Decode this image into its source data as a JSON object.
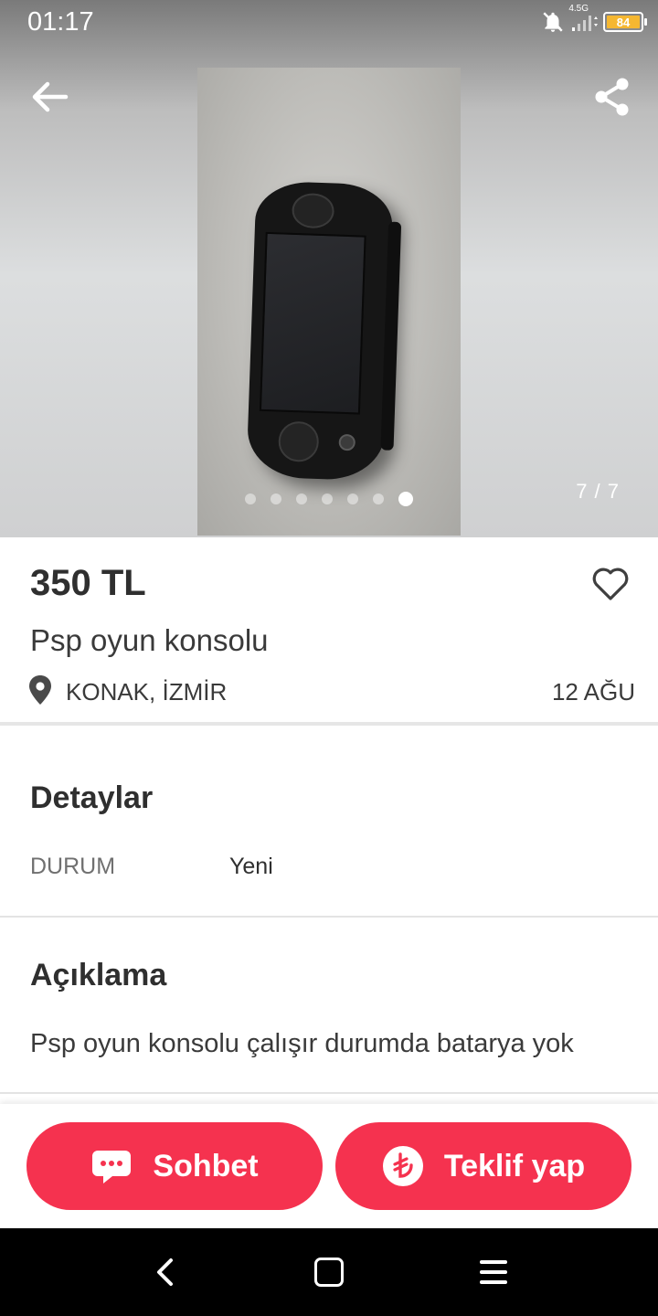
{
  "status_bar": {
    "time": "01:17",
    "network": "4.5G",
    "battery": "84",
    "icons": [
      "bell-off-icon",
      "signal-icon",
      "battery-icon"
    ]
  },
  "gallery": {
    "counter": "7 / 7",
    "dots_total": 7,
    "active_dot": 7
  },
  "listing": {
    "price": "350 TL",
    "title": "Psp oyun konsolu",
    "location": "KONAK, İZMİR",
    "date": "12 AĞU"
  },
  "details": {
    "title": "Detaylar",
    "rows": [
      {
        "key": "DURUM",
        "value": "Yeni"
      }
    ]
  },
  "description": {
    "title": "Açıklama",
    "text": "Psp oyun konsolu çalışır durumda batarya yok"
  },
  "actions": {
    "chat_label": "Sohbet",
    "offer_label": "Teklif yap"
  },
  "colors": {
    "accent": "#f5324f",
    "battery": "#f5b731",
    "text": "#2f2f2f",
    "muted": "#707070"
  }
}
